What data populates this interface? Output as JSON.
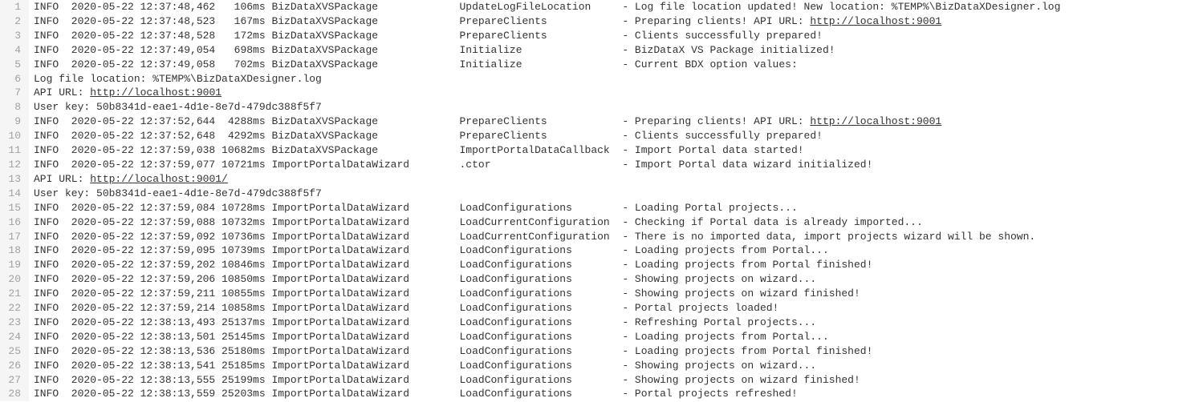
{
  "lines": [
    {
      "n": 1,
      "segments": [
        {
          "t": "INFO  2020-05-22 12:37:48,462   106ms BizDataXVSPackage             UpdateLogFileLocation     - Log file location updated! New location: %TEMP%\\BizDataXDesigner.log"
        }
      ]
    },
    {
      "n": 2,
      "segments": [
        {
          "t": "INFO  2020-05-22 12:37:48,523   167ms BizDataXVSPackage             PrepareClients            - Preparing clients! API URL: "
        },
        {
          "t": "http://localhost:9001",
          "link": true
        }
      ]
    },
    {
      "n": 3,
      "segments": [
        {
          "t": "INFO  2020-05-22 12:37:48,528   172ms BizDataXVSPackage             PrepareClients            - Clients successfully prepared!"
        }
      ]
    },
    {
      "n": 4,
      "segments": [
        {
          "t": "INFO  2020-05-22 12:37:49,054   698ms BizDataXVSPackage             Initialize                - BizDataX VS Package initialized!"
        }
      ]
    },
    {
      "n": 5,
      "segments": [
        {
          "t": "INFO  2020-05-22 12:37:49,058   702ms BizDataXVSPackage             Initialize                - Current BDX option values:"
        }
      ]
    },
    {
      "n": 6,
      "segments": [
        {
          "t": "Log file location: %TEMP%\\BizDataXDesigner.log"
        }
      ]
    },
    {
      "n": 7,
      "segments": [
        {
          "t": "API URL: "
        },
        {
          "t": "http://localhost:9001",
          "link": true
        }
      ]
    },
    {
      "n": 8,
      "segments": [
        {
          "t": "User key: 50b8341d-eae1-4d1e-8e7d-479dc388f5f7"
        }
      ]
    },
    {
      "n": 9,
      "segments": [
        {
          "t": "INFO  2020-05-22 12:37:52,644  4288ms BizDataXVSPackage             PrepareClients            - Preparing clients! API URL: "
        },
        {
          "t": "http://localhost:9001",
          "link": true
        }
      ]
    },
    {
      "n": 10,
      "segments": [
        {
          "t": "INFO  2020-05-22 12:37:52,648  4292ms BizDataXVSPackage             PrepareClients            - Clients successfully prepared!"
        }
      ]
    },
    {
      "n": 11,
      "segments": [
        {
          "t": "INFO  2020-05-22 12:37:59,038 10682ms BizDataXVSPackage             ImportPortalDataCallback  - Import Portal data started!"
        }
      ]
    },
    {
      "n": 12,
      "segments": [
        {
          "t": "INFO  2020-05-22 12:37:59,077 10721ms ImportPortalDataWizard        .ctor                     - Import Portal data wizard initialized!"
        }
      ]
    },
    {
      "n": 13,
      "segments": [
        {
          "t": "API URL: "
        },
        {
          "t": "http://localhost:9001/",
          "link": true
        }
      ]
    },
    {
      "n": 14,
      "segments": [
        {
          "t": "User key: 50b8341d-eae1-4d1e-8e7d-479dc388f5f7"
        }
      ]
    },
    {
      "n": 15,
      "segments": [
        {
          "t": "INFO  2020-05-22 12:37:59,084 10728ms ImportPortalDataWizard        LoadConfigurations        - Loading Portal projects..."
        }
      ]
    },
    {
      "n": 16,
      "segments": [
        {
          "t": "INFO  2020-05-22 12:37:59,088 10732ms ImportPortalDataWizard        LoadCurrentConfiguration  - Checking if Portal data is already imported..."
        }
      ]
    },
    {
      "n": 17,
      "segments": [
        {
          "t": "INFO  2020-05-22 12:37:59,092 10736ms ImportPortalDataWizard        LoadCurrentConfiguration  - There is no imported data, import projects wizard will be shown."
        }
      ]
    },
    {
      "n": 18,
      "segments": [
        {
          "t": "INFO  2020-05-22 12:37:59,095 10739ms ImportPortalDataWizard        LoadConfigurations        - Loading projects from Portal..."
        }
      ]
    },
    {
      "n": 19,
      "segments": [
        {
          "t": "INFO  2020-05-22 12:37:59,202 10846ms ImportPortalDataWizard        LoadConfigurations        - Loading projects from Portal finished!"
        }
      ]
    },
    {
      "n": 20,
      "segments": [
        {
          "t": "INFO  2020-05-22 12:37:59,206 10850ms ImportPortalDataWizard        LoadConfigurations        - Showing projects on wizard..."
        }
      ]
    },
    {
      "n": 21,
      "segments": [
        {
          "t": "INFO  2020-05-22 12:37:59,211 10855ms ImportPortalDataWizard        LoadConfigurations        - Showing projects on wizard finished!"
        }
      ]
    },
    {
      "n": 22,
      "segments": [
        {
          "t": "INFO  2020-05-22 12:37:59,214 10858ms ImportPortalDataWizard        LoadConfigurations        - Portal projects loaded!"
        }
      ]
    },
    {
      "n": 23,
      "segments": [
        {
          "t": "INFO  2020-05-22 12:38:13,493 25137ms ImportPortalDataWizard        LoadConfigurations        - Refreshing Portal projects..."
        }
      ]
    },
    {
      "n": 24,
      "segments": [
        {
          "t": "INFO  2020-05-22 12:38:13,501 25145ms ImportPortalDataWizard        LoadConfigurations        - Loading projects from Portal..."
        }
      ]
    },
    {
      "n": 25,
      "segments": [
        {
          "t": "INFO  2020-05-22 12:38:13,536 25180ms ImportPortalDataWizard        LoadConfigurations        - Loading projects from Portal finished!"
        }
      ]
    },
    {
      "n": 26,
      "segments": [
        {
          "t": "INFO  2020-05-22 12:38:13,541 25185ms ImportPortalDataWizard        LoadConfigurations        - Showing projects on wizard..."
        }
      ]
    },
    {
      "n": 27,
      "segments": [
        {
          "t": "INFO  2020-05-22 12:38:13,555 25199ms ImportPortalDataWizard        LoadConfigurations        - Showing projects on wizard finished!"
        }
      ]
    },
    {
      "n": 28,
      "segments": [
        {
          "t": "INFO  2020-05-22 12:38:13,559 25203ms ImportPortalDataWizard        LoadConfigurations        - Portal projects refreshed!"
        }
      ]
    }
  ]
}
